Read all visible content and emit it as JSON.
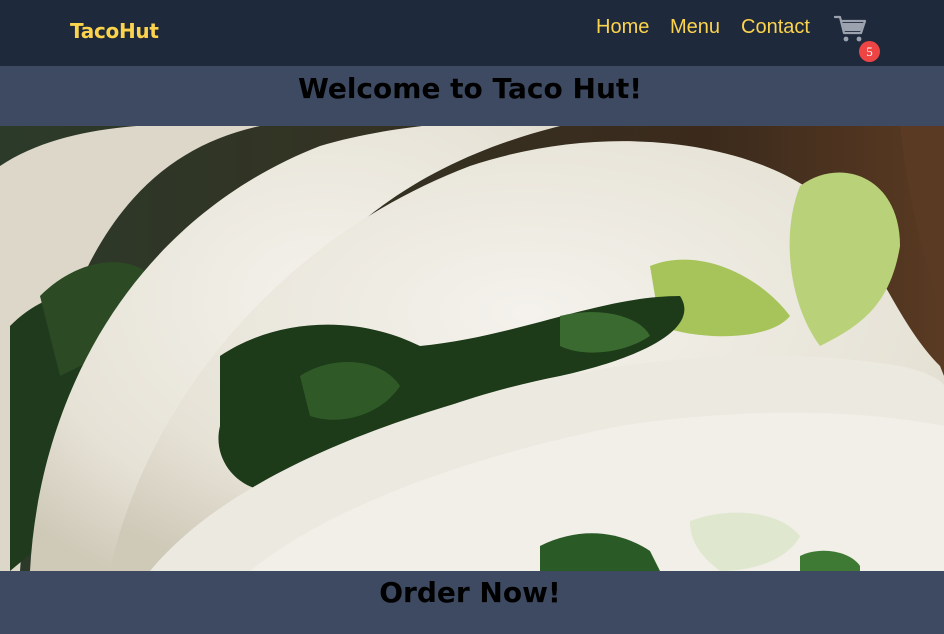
{
  "navbar": {
    "brand": "TacoHut",
    "links": [
      {
        "label": "Home"
      },
      {
        "label": "Menu"
      },
      {
        "label": "Contact"
      }
    ],
    "cart": {
      "icon": "cart-icon",
      "count": "5",
      "badge_color": "#ef4444"
    }
  },
  "welcome": {
    "title": "Welcome to Taco Hut!"
  },
  "hero": {
    "image": "tacos-photo"
  },
  "cta": {
    "title": "Order Now!"
  },
  "colors": {
    "nav_bg": "#1e293b",
    "accent": "#fcd34d",
    "band_bg": "#3d4a61"
  }
}
